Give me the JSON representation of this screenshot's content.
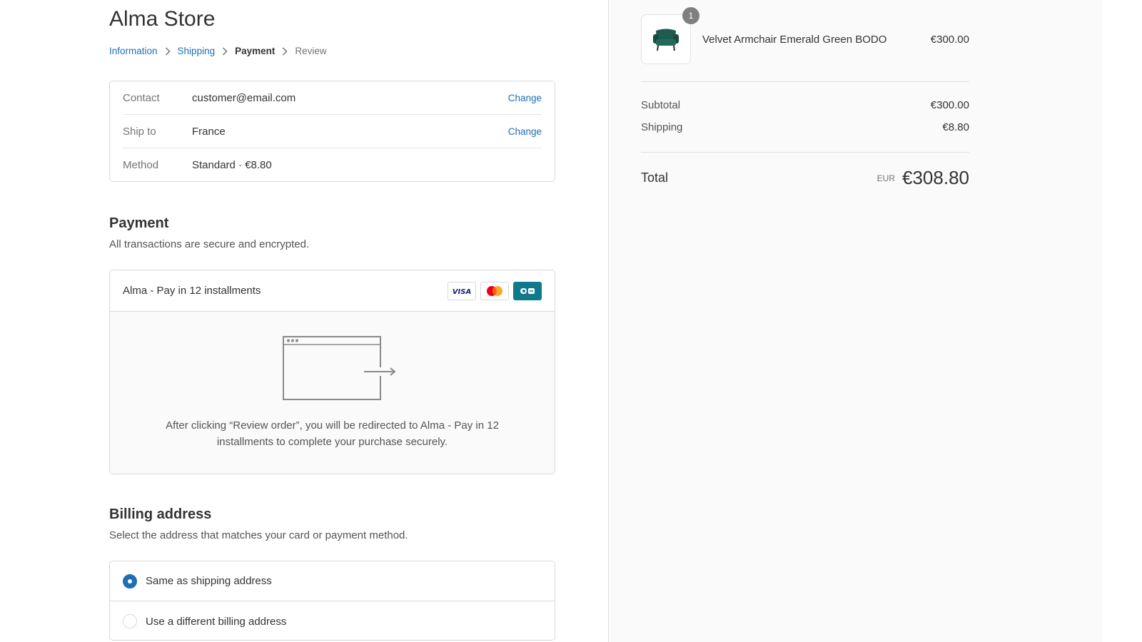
{
  "store": {
    "title": "Alma Store"
  },
  "breadcrumb": {
    "items": [
      {
        "label": "Information"
      },
      {
        "label": "Shipping"
      },
      {
        "label": "Payment"
      },
      {
        "label": "Review"
      }
    ]
  },
  "review": {
    "contact": {
      "label": "Contact",
      "value": "customer@email.com",
      "action": "Change"
    },
    "ship_to": {
      "label": "Ship to",
      "value": "France",
      "action": "Change"
    },
    "method": {
      "label": "Method",
      "value": "Standard · €8.80"
    }
  },
  "payment": {
    "title": "Payment",
    "subtitle": "All transactions are secure and encrypted.",
    "option_label": "Alma - Pay in 12 installments",
    "card_icons": [
      "visa-icon",
      "mastercard-icon",
      "cb-icon"
    ],
    "visa_text": "VISA",
    "redirect_text": "After clicking “Review order”, you will be redirected to Alma - Pay in 12 installments to complete your purchase securely."
  },
  "billing": {
    "title": "Billing address",
    "subtitle": "Select the address that matches your card or payment method.",
    "options": [
      {
        "label": "Same as shipping address",
        "selected": true
      },
      {
        "label": "Use a different billing address",
        "selected": false
      }
    ]
  },
  "summary": {
    "product": {
      "quantity": "1",
      "name": "Velvet Armchair Emerald Green BODO",
      "price": "€300.00"
    },
    "subtotal_label": "Subtotal",
    "subtotal_value": "€300.00",
    "shipping_label": "Shipping",
    "shipping_value": "€8.80",
    "total_label": "Total",
    "currency": "EUR",
    "total_value": "€308.80"
  },
  "colors": {
    "accent": "#1f6fb4",
    "sidebar_bg": "#fafafa",
    "border": "#d9d9d9",
    "product_green": "#1d5c4f"
  }
}
